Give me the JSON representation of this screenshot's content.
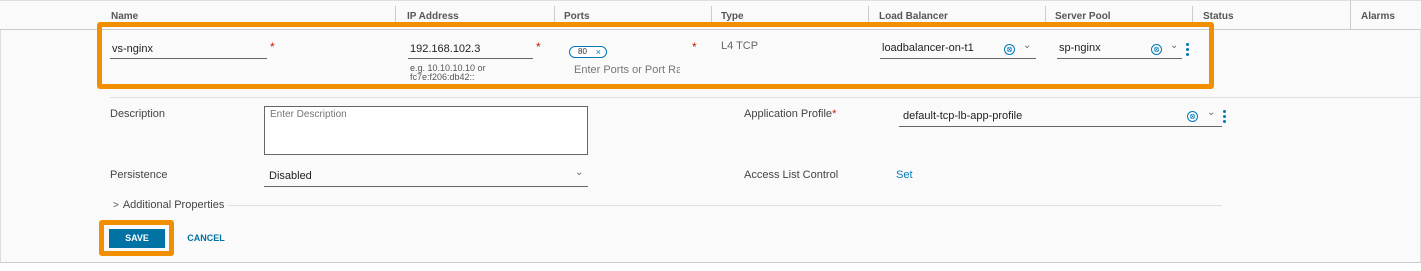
{
  "columns": {
    "name": "Name",
    "ip_address": "IP Address",
    "ports": "Ports",
    "type": "Type",
    "load_balancer": "Load Balancer",
    "server_pool": "Server Pool",
    "status": "Status",
    "alarms": "Alarms"
  },
  "row": {
    "name_value": "vs-nginx",
    "required_marker": "*",
    "ip_value": "192.168.102.3",
    "ip_hint_line1": "e.g. 10.10.10.10 or",
    "ip_hint_line2": "fc7e:f206:db42::",
    "port_chip": "80",
    "port_chip_remove": "×",
    "ports_placeholder": "Enter Ports or Port Ranges",
    "type_value": "L4 TCP",
    "load_balancer_value": "loadbalancer-on-t1",
    "server_pool_value": "sp-nginx"
  },
  "details": {
    "description_label": "Description",
    "description_placeholder": "Enter Description",
    "persistence_label": "Persistence",
    "persistence_value": "Disabled",
    "app_profile_label": "Application Profile",
    "app_profile_required": "*",
    "app_profile_value": "default-tcp-lb-app-profile",
    "access_list_label": "Access List Control",
    "access_list_link": "Set",
    "additional_properties": "Additional Properties"
  },
  "actions": {
    "save": "SAVE",
    "cancel": "CANCEL"
  },
  "icons": {
    "clear": "⊗",
    "chevron_down": "⌄",
    "chevron_right": ">"
  },
  "colors": {
    "accent": "#0079b8",
    "highlight": "#f28f00",
    "required": "#c21d00",
    "save_button": "#0072a3"
  }
}
